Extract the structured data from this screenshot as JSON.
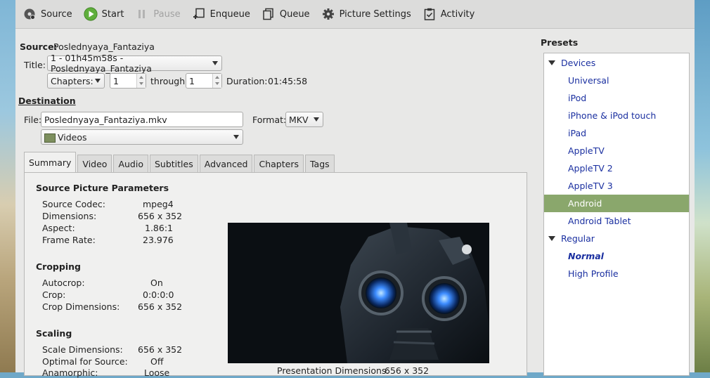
{
  "toolbar": {
    "source": "Source",
    "start": "Start",
    "pause": "Pause",
    "enqueue": "Enqueue",
    "queue": "Queue",
    "picture_settings": "Picture Settings",
    "activity": "Activity"
  },
  "source": {
    "label": "Source:",
    "name": "Poslednyaya_Fantaziya",
    "title_label": "Title:",
    "title_value": "1 - 01h45m58s - Poslednyaya_Fantaziya",
    "range_mode": "Chapters:",
    "range_start": "1",
    "through": "through",
    "range_end": "1",
    "duration_label": "Duration:",
    "duration_value": "01:45:58"
  },
  "destination": {
    "heading": "Destination",
    "file_label": "File:",
    "file_value": "Poslednyaya_Fantaziya.mkv",
    "format_label": "Format:",
    "format_value": "MKV",
    "folder": "Videos"
  },
  "tabs": [
    "Summary",
    "Video",
    "Audio",
    "Subtitles",
    "Advanced",
    "Chapters",
    "Tags"
  ],
  "summary": {
    "source_params_heading": "Source Picture Parameters",
    "source_params": [
      {
        "k": "Source Codec:",
        "v": "mpeg4"
      },
      {
        "k": "Dimensions:",
        "v": "656 x 352"
      },
      {
        "k": "Aspect:",
        "v": "1.86:1"
      },
      {
        "k": "Frame Rate:",
        "v": "23.976"
      }
    ],
    "cropping_heading": "Cropping",
    "cropping": [
      {
        "k": "Autocrop:",
        "v": "On"
      },
      {
        "k": "Crop:",
        "v": "0:0:0:0"
      },
      {
        "k": "Crop Dimensions:",
        "v": "656 x 352"
      }
    ],
    "scaling_heading": "Scaling",
    "scaling": [
      {
        "k": "Scale Dimensions:",
        "v": "656 x 352"
      },
      {
        "k": "Optimal for Source:",
        "v": "Off"
      },
      {
        "k": "Anamorphic:",
        "v": "Loose"
      }
    ],
    "presentation_label": "Presentation Dimensions:",
    "presentation_value": "656 x 352"
  },
  "presets": {
    "title": "Presets",
    "groups": [
      {
        "name": "Devices",
        "items": [
          "Universal",
          "iPod",
          "iPhone & iPod touch",
          "iPad",
          "AppleTV",
          "AppleTV 2",
          "AppleTV 3",
          "Android",
          "Android Tablet"
        ]
      },
      {
        "name": "Regular",
        "items": [
          "Normal",
          "High Profile"
        ]
      }
    ],
    "selected": "Android",
    "default": "Normal"
  },
  "colors": {
    "selection": "#8aa76c",
    "link": "#1a2fa0"
  }
}
